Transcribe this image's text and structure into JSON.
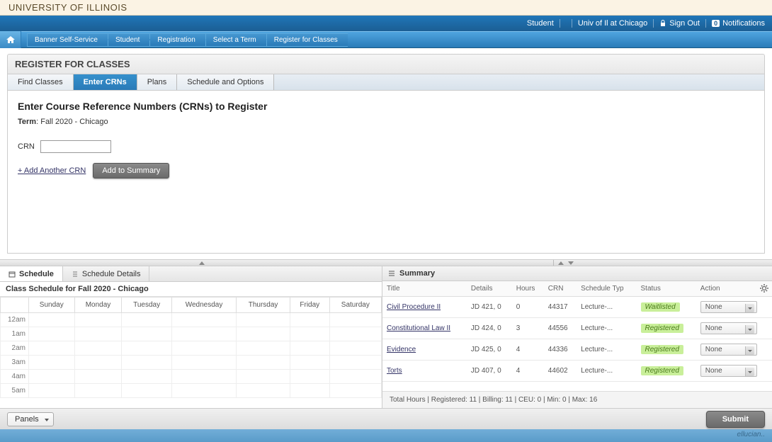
{
  "header": {
    "logo_main": "UNIVERSITY OF ILLINOIS"
  },
  "topbar": {
    "role": "Student",
    "campus": "Univ of Il at Chicago",
    "signout": "Sign Out",
    "notifications_label": "Notifications",
    "notifications_count": "0"
  },
  "breadcrumbs": [
    "Banner Self-Service",
    "Student",
    "Registration",
    "Select a Term",
    "Register for Classes"
  ],
  "page_title": "REGISTER FOR CLASSES",
  "tabs": [
    "Find Classes",
    "Enter CRNs",
    "Plans",
    "Schedule and Options"
  ],
  "active_tab": 1,
  "content": {
    "heading": "Enter Course Reference Numbers (CRNs) to Register",
    "term_label": "Term",
    "term_value": "Fall 2020 - Chicago",
    "crn_label": "CRN",
    "crn_value": "",
    "add_another": "+ Add Another CRN",
    "add_summary": "Add to Summary"
  },
  "schedule": {
    "tab_schedule": "Schedule",
    "tab_details": "Schedule Details",
    "subtitle": "Class Schedule for Fall 2020 - Chicago",
    "days": [
      "Sunday",
      "Monday",
      "Tuesday",
      "Wednesday",
      "Thursday",
      "Friday",
      "Saturday"
    ],
    "times": [
      "12am",
      "1am",
      "2am",
      "3am",
      "4am",
      "5am"
    ]
  },
  "summary": {
    "title": "Summary",
    "headers": [
      "Title",
      "Details",
      "Hours",
      "CRN",
      "Schedule Typ",
      "Status",
      "Action"
    ],
    "rows": [
      {
        "title": "Civil Procedure II",
        "details": "JD 421, 0",
        "hours": "0",
        "crn": "44317",
        "type": "Lecture-...",
        "status": "Waitlisted",
        "action": "None"
      },
      {
        "title": "Constitutional Law II",
        "details": "JD 424, 0",
        "hours": "3",
        "crn": "44556",
        "type": "Lecture-...",
        "status": "Registered",
        "action": "None"
      },
      {
        "title": "Evidence",
        "details": "JD 425, 0",
        "hours": "4",
        "crn": "44336",
        "type": "Lecture-...",
        "status": "Registered",
        "action": "None"
      },
      {
        "title": "Torts",
        "details": "JD 407, 0",
        "hours": "4",
        "crn": "44602",
        "type": "Lecture-...",
        "status": "Registered",
        "action": "None"
      }
    ],
    "footer": "Total Hours | Registered: 11 | Billing: 11 | CEU: 0 | Min: 0 | Max: 16"
  },
  "footer": {
    "panels": "Panels",
    "submit": "Submit",
    "brand": "ellucian.."
  }
}
